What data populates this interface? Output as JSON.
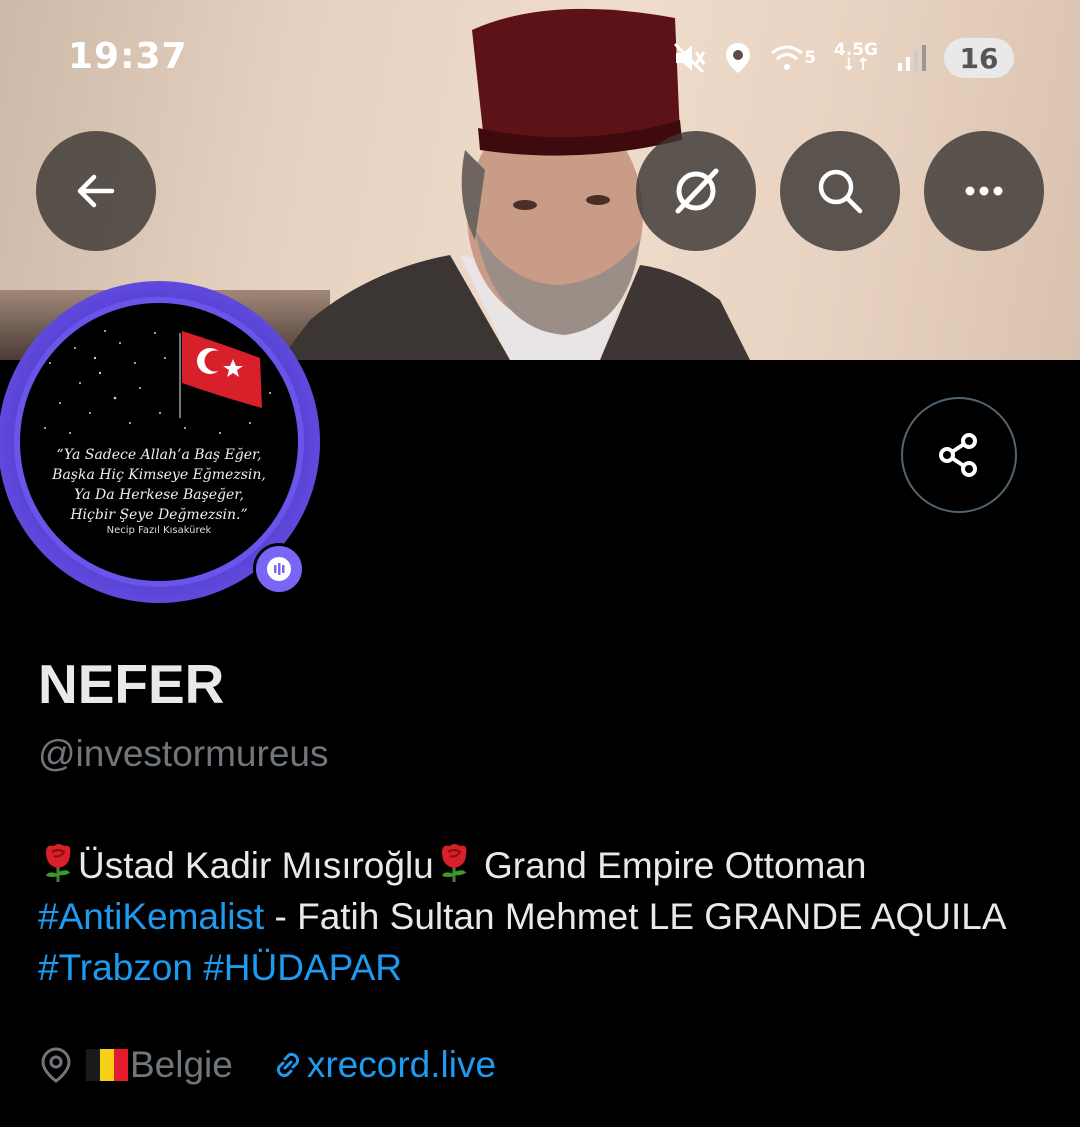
{
  "status_bar": {
    "time": "19:37",
    "network_top": "4.5G",
    "wifi_label": "5",
    "battery": "16",
    "icons": [
      "mute-icon",
      "location-icon",
      "wifi-icon",
      "mobile-data-icon",
      "signal-icon",
      "battery-icon"
    ]
  },
  "header": {
    "buttons": [
      "back-icon",
      "grok-icon",
      "search-icon",
      "more-icon"
    ]
  },
  "avatar": {
    "quote_lines": [
      "“Ya Sadece Allah’a Baş Eğer,",
      "Başka Hiç Kimseye Eğmezsin,",
      "Ya Da Herkese Başeğer,",
      "Hiçbir Şeye Değmezsin.”"
    ],
    "author": "Necip Fazıl Kısakürek",
    "badge_icon": "spaces-icon"
  },
  "profile": {
    "display_name": "NEFER",
    "handle": "@investormureus",
    "bio": {
      "text_1": "Üstad Kadir Mısıroğlu",
      "text_2": " Grand Empire Ottoman",
      "hashtag_1": "#AntiKemalist",
      "text_3": " - Fatih Sultan Mehmet LE GRANDE AQUILA ",
      "hashtag_2": "#Trabzon",
      "hashtag_3": "#HÜDAPAR",
      "emoji": "rose-icon"
    },
    "location": "Belgie",
    "website": "xrecord.live"
  },
  "colors": {
    "accent": "#1d9bf0",
    "secondary_text": "#71767b",
    "avatar_ring": "#7a66f5",
    "belgium_flag": [
      "#1a1a1a",
      "#f7d117",
      "#e41b2d"
    ]
  }
}
